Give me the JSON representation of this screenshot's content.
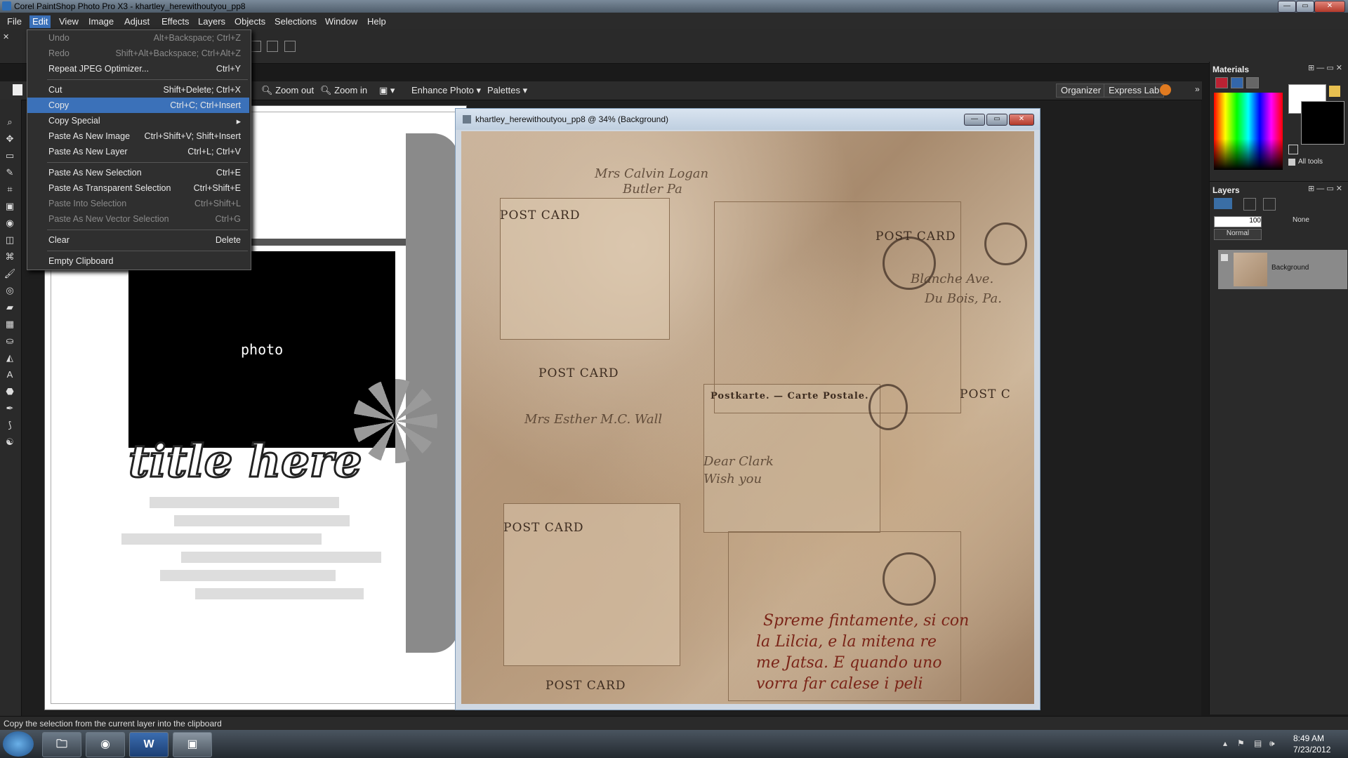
{
  "window": {
    "title": "Corel PaintShop Photo Pro X3 - khartley_herewithoutyou_pp8"
  },
  "menubar": [
    "File",
    "Edit",
    "View",
    "Image",
    "Adjust",
    "Effects",
    "Layers",
    "Objects",
    "Selections",
    "Window",
    "Help"
  ],
  "toolbar": {
    "zoom_out": "Zoom out",
    "zoom_in": "Zoom in",
    "enhance_photo": "Enhance Photo",
    "palettes": "Palettes",
    "organizer": "Organizer",
    "express_lab": "Express Lab"
  },
  "edit_menu": [
    {
      "label": "Undo",
      "shortcut": "Alt+Backspace; Ctrl+Z",
      "disabled": true
    },
    {
      "label": "Redo",
      "shortcut": "Shift+Alt+Backspace; Ctrl+Alt+Z",
      "disabled": true
    },
    {
      "label": "Repeat JPEG Optimizer...",
      "shortcut": "Ctrl+Y",
      "disabled": false
    },
    {
      "label": "Cut",
      "shortcut": "Shift+Delete; Ctrl+X",
      "disabled": false
    },
    {
      "label": "Copy",
      "shortcut": "Ctrl+C; Ctrl+Insert",
      "disabled": false,
      "highlighted": true
    },
    {
      "label": "Copy Special",
      "shortcut": "",
      "disabled": false,
      "submenu": true
    },
    {
      "label": "Paste As New Image",
      "shortcut": "Ctrl+Shift+V; Shift+Insert",
      "disabled": false
    },
    {
      "label": "Paste As New Layer",
      "shortcut": "Ctrl+L; Ctrl+V",
      "disabled": false
    },
    {
      "label": "Paste As New Selection",
      "shortcut": "Ctrl+E",
      "disabled": false
    },
    {
      "label": "Paste As Transparent Selection",
      "shortcut": "Ctrl+Shift+E",
      "disabled": false
    },
    {
      "label": "Paste Into Selection",
      "shortcut": "Ctrl+Shift+L",
      "disabled": true
    },
    {
      "label": "Paste As New Vector Selection",
      "shortcut": "Ctrl+G",
      "disabled": true
    },
    {
      "label": "Clear",
      "shortcut": "Delete",
      "disabled": false
    },
    {
      "label": "Empty Clipboard",
      "shortcut": "",
      "disabled": false
    }
  ],
  "template_doc": {
    "photo_label": "photo",
    "title_text": "title here"
  },
  "photo_doc": {
    "title": "khartley_herewithoutyou_pp8 @ 34% (Background)",
    "texts": {
      "post_card_1": "POST CARD",
      "post_card_2": "POST CARD",
      "post_card_3": "POST CARD",
      "post_card_4": "POST CARD",
      "post_card_5": "POST CARD",
      "postkarte": "Postkarte. — Carte Postale.",
      "post_c": "POST C",
      "hand_1": "Mrs Calvin Logan",
      "hand_2": "Butler Pa",
      "hand_3": "Blanche Ave.",
      "hand_4": "Du Bois, Pa.",
      "hand_5": "Mrs Esther M.C. Wall",
      "hand_6": "Dear Clark",
      "hand_7": "Wish you",
      "red_1": "Spreme fintamente, si con",
      "red_2": "la Lilcia, e la mitena re",
      "red_3": "me Jatsa. E quando uno",
      "red_4": "vorra far calese i peli"
    }
  },
  "materials": {
    "title": "Materials",
    "all_tools": "All tools"
  },
  "layers": {
    "title": "Layers",
    "opacity": "100",
    "none_label": "None",
    "blend": "Normal",
    "background_layer": "Background"
  },
  "statusbar": {
    "text": "Copy the selection from the current layer into the clipboard"
  },
  "taskbar": {
    "time": "8:49 AM",
    "date": "7/23/2012",
    "word_label": "W"
  },
  "colors": {
    "accent": "#3b71b9",
    "panel": "#2a2a2a"
  }
}
